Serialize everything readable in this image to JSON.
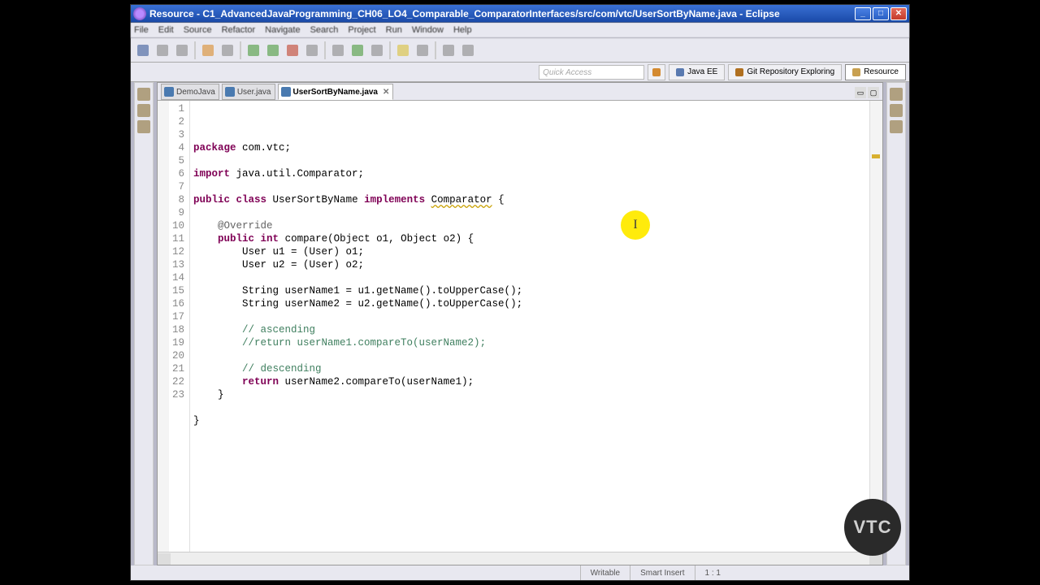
{
  "window": {
    "title": "Resource - C1_AdvancedJavaProgramming_CH06_LO4_Comparable_ComparatorInterfaces/src/com/vtc/UserSortByName.java - Eclipse"
  },
  "menu": {
    "items": [
      "File",
      "Edit",
      "Source",
      "Refactor",
      "Navigate",
      "Search",
      "Project",
      "Run",
      "Window",
      "Help"
    ]
  },
  "quick_access": {
    "placeholder": "Quick Access"
  },
  "perspectives": {
    "java_ee": "Java EE",
    "git": "Git Repository Exploring",
    "resource": "Resource"
  },
  "tabs": [
    {
      "label": "DemoJava",
      "active": false
    },
    {
      "label": "User.java",
      "active": false
    },
    {
      "label": "UserSortByName.java",
      "active": true
    }
  ],
  "code": {
    "lines": [
      {
        "n": "1",
        "html": "<span class='kw'>package</span> com.vtc;"
      },
      {
        "n": "2",
        "html": ""
      },
      {
        "n": "3",
        "html": "<span class='kw'>import</span> java.util.Comparator;"
      },
      {
        "n": "4",
        "html": ""
      },
      {
        "n": "5",
        "html": "<span class='kw'>public</span> <span class='kw'>class</span> UserSortByName <span class='kw'>implements</span> <span class='warn-underline'>Comparator</span> {",
        "warn": true
      },
      {
        "n": "6",
        "html": ""
      },
      {
        "n": "7",
        "html": "    <span class='ann'>@Override</span>",
        "ov": true
      },
      {
        "n": "8",
        "html": "    <span class='kw'>public</span> <span class='kw'>int</span> compare(Object o1, Object o2) {"
      },
      {
        "n": "9",
        "html": "        User u1 = (User) o1;"
      },
      {
        "n": "10",
        "html": "        User u2 = (User) o2;"
      },
      {
        "n": "11",
        "html": ""
      },
      {
        "n": "12",
        "html": "        String userName1 = u1.getName().toUpperCase();"
      },
      {
        "n": "13",
        "html": "        String userName2 = u2.getName().toUpperCase();"
      },
      {
        "n": "14",
        "html": ""
      },
      {
        "n": "15",
        "html": "        <span class='cmt'>// ascending</span>"
      },
      {
        "n": "16",
        "html": "        <span class='cmt'>//return userName1.compareTo(userName2);</span>"
      },
      {
        "n": "17",
        "html": ""
      },
      {
        "n": "18",
        "html": "        <span class='cmt'>// descending</span>"
      },
      {
        "n": "19",
        "html": "        <span class='kw'>return</span> userName2.compareTo(userName1);"
      },
      {
        "n": "20",
        "html": "    }"
      },
      {
        "n": "21",
        "html": ""
      },
      {
        "n": "22",
        "html": "}"
      },
      {
        "n": "23",
        "html": ""
      }
    ]
  },
  "status": {
    "writable": "Writable",
    "insert": "Smart Insert",
    "pos": "1 : 1"
  },
  "badge": {
    "label": "VTC"
  }
}
